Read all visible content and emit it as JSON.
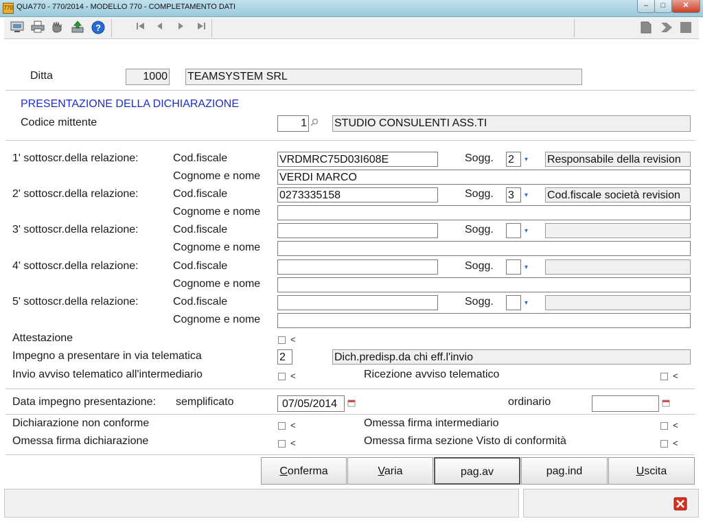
{
  "window": {
    "app_icon": "770",
    "title": "QUA770 - 770/2014 - MODELLO 770 - COMPLETAMENTO DATI",
    "minimize": "–",
    "maximize": "□",
    "close": "✕"
  },
  "toolbar": {
    "icons": [
      "monitor-icon",
      "printer-icon",
      "hand-icon",
      "export-icon",
      "help-icon",
      "first-icon",
      "prev-icon",
      "next-icon",
      "last-icon",
      "doc-icon",
      "forward-icon",
      "stop-icon"
    ]
  },
  "ditta": {
    "label": "Ditta",
    "code": "1000",
    "name": "TEAMSYSTEM SRL"
  },
  "presentazione": {
    "heading": "PRESENTAZIONE DELLA DICHIARAZIONE",
    "codice_label": "Codice mittente",
    "codice_value": "1",
    "codice_desc": "STUDIO CONSULENTI ASS.TI"
  },
  "labels": {
    "codfiscale": "Cod.fiscale",
    "cognome": "Cognome e nome",
    "sogg": "Sogg."
  },
  "sottoscrittori": [
    {
      "label": "1' sottoscr.della relazione:",
      "codfiscale": "VRDMRC75D03I608E",
      "sogg": "2",
      "sogg_desc": "Responsabile della revision",
      "cognome": "VERDI MARCO"
    },
    {
      "label": "2' sottoscr.della relazione:",
      "codfiscale": "0273335158",
      "sogg": "3",
      "sogg_desc": "Cod.fiscale società revision",
      "cognome": ""
    },
    {
      "label": "3' sottoscr.della relazione:",
      "codfiscale": "",
      "sogg": "",
      "sogg_desc": "",
      "cognome": ""
    },
    {
      "label": "4' sottoscr.della relazione:",
      "codfiscale": "",
      "sogg": "",
      "sogg_desc": "",
      "cognome": ""
    },
    {
      "label": "5' sottoscr.della relazione:",
      "codfiscale": "",
      "sogg": "",
      "sogg_desc": "",
      "cognome": ""
    }
  ],
  "attestazione": {
    "label": "Attestazione"
  },
  "impegno": {
    "label": "Impegno a presentare in via telematica",
    "value": "2",
    "desc": "Dich.predisp.da chi eff.l'invio"
  },
  "invio_avviso": {
    "label": "Invio avviso telematico all'intermediario"
  },
  "ricezione_avviso": {
    "label": "Ricezione avviso telematico"
  },
  "data_impegno": {
    "label": "Data impegno presentazione:",
    "semplificato_label": "semplificato",
    "semplificato_value": "07/05/2014",
    "ordinario_label": "ordinario",
    "ordinario_value": ""
  },
  "flags": {
    "non_conforme": "Dichiarazione non conforme",
    "omessa_firma_intermediario": "Omessa firma intermediario",
    "omessa_firma_dichiarazione": "Omessa firma dichiarazione",
    "omessa_firma_visto": "Omessa firma sezione Visto di conformità"
  },
  "arrow_glyph": "<",
  "buttons": {
    "conferma_key": "C",
    "conferma_rest": "onferma",
    "varia_key": "V",
    "varia_rest": "aria",
    "pag_av": "pag.av",
    "pag_ind": "pag.ind",
    "uscita_key": "U",
    "uscita_rest": "scita"
  }
}
